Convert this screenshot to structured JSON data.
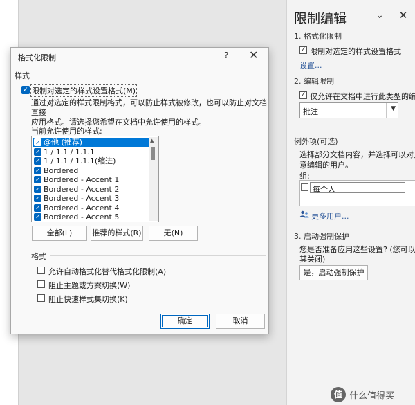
{
  "pane": {
    "title": "限制编辑",
    "chevron_icon": "chevron-down-icon",
    "close_icon": "close-icon",
    "section1_title": "1. 格式化限制",
    "section1_check_label": "限制对选定的样式设置格式",
    "section1_link": "设置...",
    "section2_title": "2. 编辑限制",
    "section2_check_label": "仅允许在文档中进行此类型的编辑",
    "edit_type_value": "批注",
    "exceptions_title": "例外项(可选)",
    "exceptions_desc_line1": "选择部分文档内容，并选择可以对其",
    "exceptions_desc_line2": "意编辑的用户。",
    "group_label": "组:",
    "group_item": "每个人",
    "more_users_link": "更多用户...",
    "section3_title": "3. 启动强制保护",
    "section3_desc_line1": "您是否准备应用这些设置? (您可以稍",
    "section3_desc_line2": "其关闭)",
    "enforce_button": "是，启动强制保护"
  },
  "dialog": {
    "title": "格式化限制",
    "help_icon": "help-icon",
    "close_icon": "close-icon",
    "styles_group": "样式",
    "main_check_label": "限制对选定的样式设置格式(M)",
    "desc_line1": "通过对选定的样式限制格式，可以防止样式被修改，也可以防止对文档直接",
    "desc_line2": "应用格式。请选择您希望在文档中允许使用的样式。",
    "list_label": "当前允许使用的样式:",
    "styles": [
      {
        "label": "@他 (推荐)",
        "checked": true,
        "selected": true
      },
      {
        "label": "1 / 1.1 / 1.1.1",
        "checked": true,
        "selected": false
      },
      {
        "label": "1 / 1.1 / 1.1.1(缩进)",
        "checked": true,
        "selected": false
      },
      {
        "label": "Bordered",
        "checked": true,
        "selected": false
      },
      {
        "label": "Bordered - Accent 1",
        "checked": true,
        "selected": false
      },
      {
        "label": "Bordered - Accent 2",
        "checked": true,
        "selected": false
      },
      {
        "label": "Bordered - Accent 3",
        "checked": true,
        "selected": false
      },
      {
        "label": "Bordered - Accent 4",
        "checked": true,
        "selected": false
      },
      {
        "label": "Bordered - Accent 5",
        "checked": true,
        "selected": false
      }
    ],
    "btn_all": "全部(L)",
    "btn_recommended": "推荐的样式(R)",
    "btn_none": "无(N)",
    "format_group": "格式",
    "opt1": "允许自动格式化替代格式化限制(A)",
    "opt2": "阻止主题或方案切换(W)",
    "opt3": "阻止快速样式集切换(K)",
    "ok": "确定",
    "cancel": "取消"
  },
  "watermark": {
    "badge": "值",
    "text": "什么值得买"
  },
  "colors": {
    "accent": "#0067c0",
    "selection": "#0078d7",
    "link": "#2b579a"
  }
}
